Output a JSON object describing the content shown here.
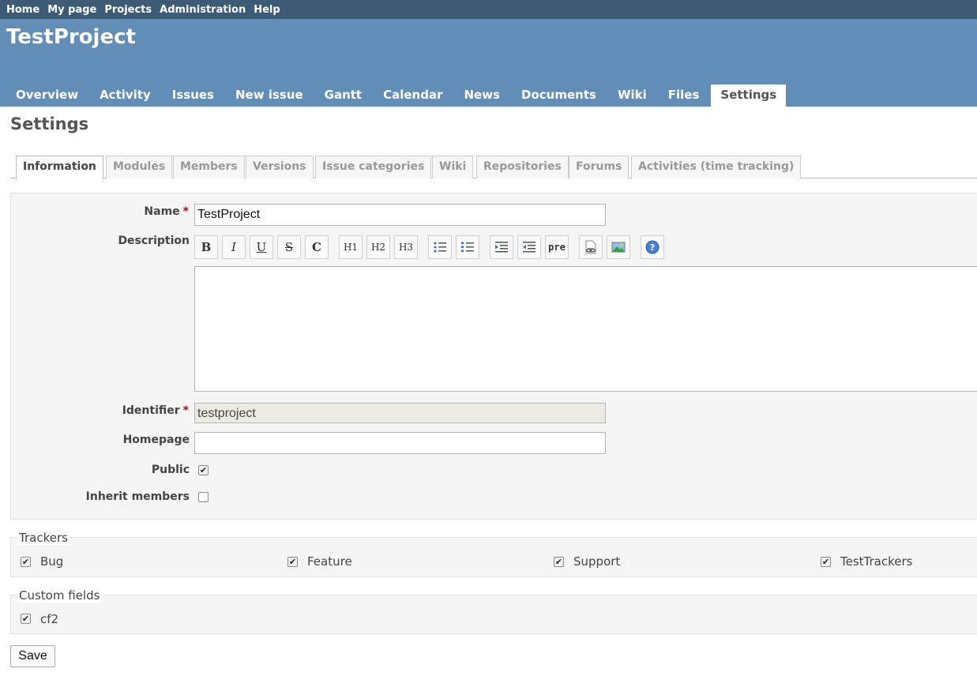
{
  "top_menu": [
    "Home",
    "My page",
    "Projects",
    "Administration",
    "Help"
  ],
  "project": {
    "title": "TestProject"
  },
  "main_menu": [
    "Overview",
    "Activity",
    "Issues",
    "New issue",
    "Gantt",
    "Calendar",
    "News",
    "Documents",
    "Wiki",
    "Files",
    "Settings"
  ],
  "main_menu_selected": "Settings",
  "page": {
    "heading": "Settings"
  },
  "subtabs": [
    "Information",
    "Modules",
    "Members",
    "Versions",
    "Issue categories",
    "Wiki",
    "Repositories",
    "Forums",
    "Activities (time tracking)"
  ],
  "subtab_selected": "Information",
  "form": {
    "name_label": "Name",
    "name_value": "TestProject",
    "description_label": "Description",
    "identifier_label": "Identifier",
    "identifier_value": "testproject",
    "homepage_label": "Homepage",
    "homepage_value": "",
    "public_label": "Public",
    "public_checked": true,
    "inherit_label": "Inherit members",
    "inherit_checked": false,
    "required_mark": "*"
  },
  "toolbar": [
    {
      "name": "bold-button",
      "glyph": "B"
    },
    {
      "name": "italic-button",
      "glyph": "I"
    },
    {
      "name": "underline-button",
      "glyph": "U"
    },
    {
      "name": "strikethrough-button",
      "glyph": "S"
    },
    {
      "name": "code-button",
      "glyph": "C"
    },
    {
      "name": "heading1-button",
      "glyph": "H1"
    },
    {
      "name": "heading2-button",
      "glyph": "H2"
    },
    {
      "name": "heading3-button",
      "glyph": "H3"
    },
    {
      "name": "unordered-list-button",
      "glyph": "ul-icon"
    },
    {
      "name": "ordered-list-button",
      "glyph": "ol-icon"
    },
    {
      "name": "quote-button",
      "glyph": "quote-icon"
    },
    {
      "name": "unquote-button",
      "glyph": "unquote-icon"
    },
    {
      "name": "preformatted-button",
      "glyph": "pre"
    },
    {
      "name": "link-button",
      "glyph": "link-icon"
    },
    {
      "name": "image-button",
      "glyph": "image-icon"
    },
    {
      "name": "help-button",
      "glyph": "help-icon"
    }
  ],
  "trackers": {
    "legend": "Trackers",
    "items": [
      {
        "label": "Bug",
        "checked": true
      },
      {
        "label": "Feature",
        "checked": true
      },
      {
        "label": "Support",
        "checked": true
      },
      {
        "label": "TestTrackers",
        "checked": true
      }
    ]
  },
  "custom_fields": {
    "legend": "Custom fields",
    "items": [
      {
        "label": "cf2",
        "checked": true
      }
    ]
  },
  "save_label": "Save",
  "colors": {
    "top_menu_bg": "#3e5b76",
    "header_bg": "#628db6",
    "required": "#bb0000"
  }
}
